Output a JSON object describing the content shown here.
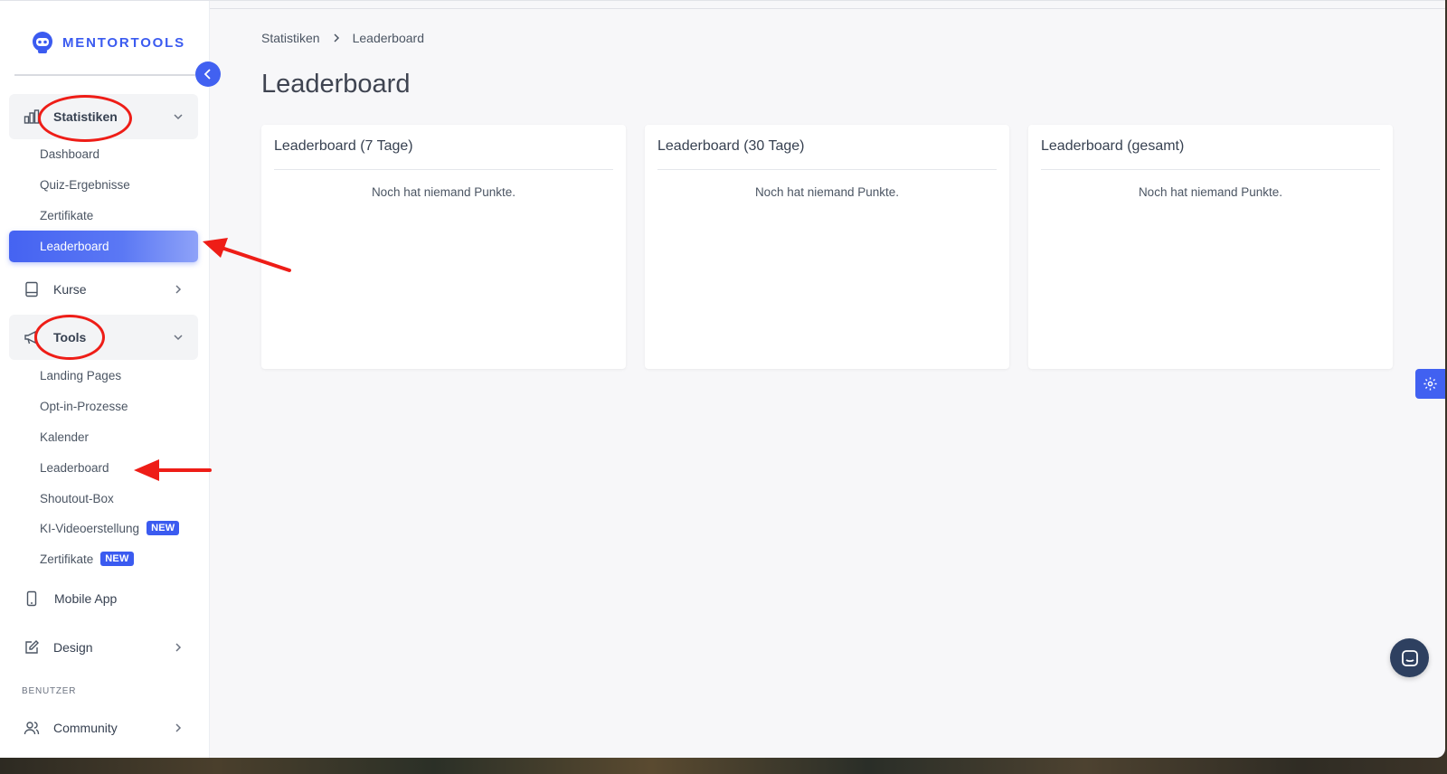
{
  "brand": {
    "name": "MENTORTOOLS",
    "accent": "#3b5bf0"
  },
  "sidebar": {
    "groups": {
      "statistiken": {
        "label": "Statistiken",
        "items": [
          "Dashboard",
          "Quiz-Ergebnisse",
          "Zertifikate",
          "Leaderboard"
        ],
        "active_item": "Leaderboard"
      },
      "kurse": {
        "label": "Kurse"
      },
      "tools": {
        "label": "Tools",
        "items": [
          {
            "label": "Landing Pages"
          },
          {
            "label": "Opt-in-Prozesse"
          },
          {
            "label": "Kalender"
          },
          {
            "label": "Leaderboard"
          },
          {
            "label": "Shoutout-Box"
          },
          {
            "label": "KI-Videoerstellung",
            "badge": "NEW"
          },
          {
            "label": "Zertifikate",
            "badge": "NEW"
          }
        ]
      },
      "mobile_app": {
        "label": "Mobile App"
      },
      "design": {
        "label": "Design"
      }
    },
    "section_benutzer": "BENUTZER",
    "community": {
      "label": "Community"
    }
  },
  "breadcrumb": [
    "Statistiken",
    "Leaderboard"
  ],
  "page_title": "Leaderboard",
  "cards": [
    {
      "title": "Leaderboard (7 Tage)",
      "empty_text": "Noch hat niemand Punkte."
    },
    {
      "title": "Leaderboard (30 Tage)",
      "empty_text": "Noch hat niemand Punkte."
    },
    {
      "title": "Leaderboard (gesamt)",
      "empty_text": "Noch hat niemand Punkte."
    }
  ],
  "colors": {
    "annotation": "#ee1d17",
    "active_nav": "#4563f2",
    "chat": "#2e4060"
  }
}
